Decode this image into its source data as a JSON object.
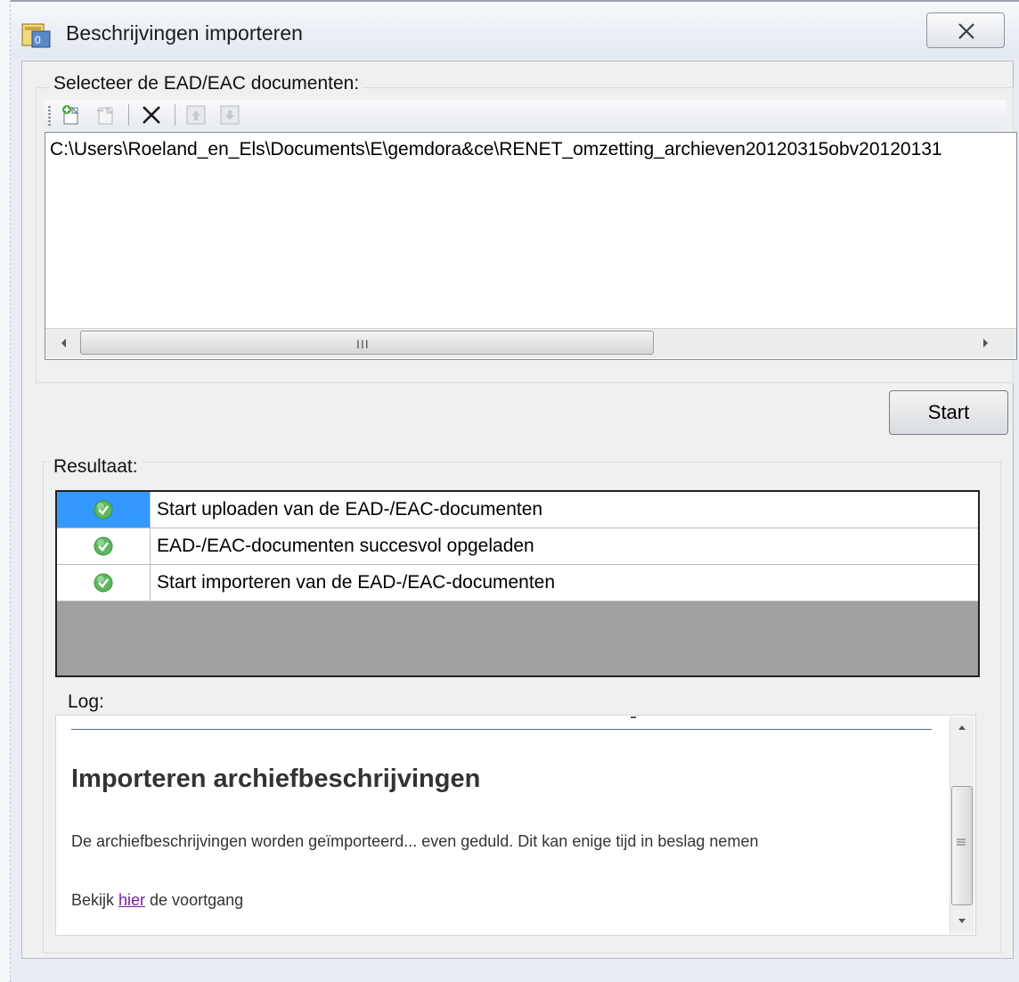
{
  "window": {
    "title": "Beschrijvingen importeren",
    "close_icon": "close-icon"
  },
  "selection": {
    "label": "Selecteer de EAD/EAC documenten:",
    "toolbar": [
      {
        "name": "add-document-icon"
      },
      {
        "name": "remove-document-icon"
      },
      {
        "name": "delete-icon"
      },
      {
        "name": "move-up-icon"
      },
      {
        "name": "move-down-icon"
      }
    ],
    "files": [
      "C:\\Users\\Roeland_en_Els\\Documents\\E\\gemdora&ce\\RENET_omzetting_archieven20120315obv20120131"
    ],
    "scrollbar_grip": "III"
  },
  "start_button": {
    "label": "Start"
  },
  "result": {
    "label": "Resultaat:",
    "rows": [
      {
        "status": "check-icon",
        "text": "Start uploaden van de EAD-/EAC-documenten",
        "selected": true
      },
      {
        "status": "check-icon",
        "text": "EAD-/EAC-documenten succesvol opgeladen",
        "selected": false
      },
      {
        "status": "check-icon",
        "text": "Start importeren van de EAD-/EAC-documenten",
        "selected": false
      }
    ]
  },
  "log": {
    "label": "Log:",
    "heading": "Importeren archiefbeschrijvingen",
    "message": "De archiefbeschrijvingen worden geïmporteerd... even geduld. Dit kan enige tijd in beslag nemen",
    "progress_prefix": "Bekijk ",
    "progress_link": "hier",
    "progress_suffix": " de voortgang"
  },
  "colors": {
    "selection": "#3399ff",
    "link": "#7a1a9c",
    "check": "#5cb85c"
  }
}
